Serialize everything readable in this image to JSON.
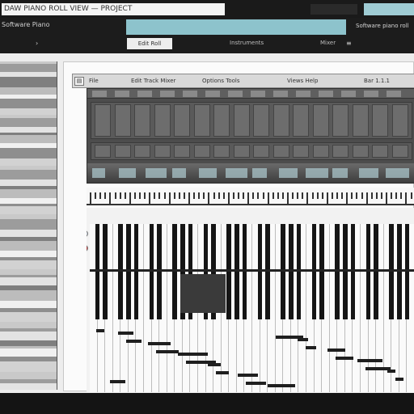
{
  "topbar": {
    "address": "DAW PIANO ROLL VIEW — PROJECT",
    "mid_button": "",
    "accent": "#9fccd4"
  },
  "toolbar": {
    "left_label": "Software Piano",
    "teal_field": "",
    "right_label": "Software piano roll",
    "subtabs": [
      "Edit Roll",
      "Instruments",
      "Mixer"
    ],
    "icons": [
      "chevron-icon",
      "menu-icon"
    ]
  },
  "daw": {
    "header_cells": [
      "File",
      "Edit  Track  Mixer",
      "Options  Tools",
      "Views  Help",
      "Bar 1.1.1"
    ],
    "colors": {
      "panel": "#4d4d4d",
      "white_key": "#fafafa",
      "black_key": "#151515"
    }
  },
  "piano": {
    "octaves": 6
  }
}
